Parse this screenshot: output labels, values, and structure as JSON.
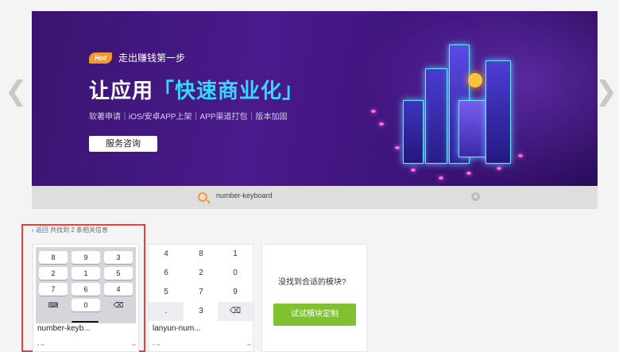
{
  "banner": {
    "hot_badge": "Hot",
    "hot_text": "走出赚钱第一步",
    "title_prefix": "让应用",
    "title_highlight": "「快速商业化」",
    "subtitle": "软著申请｜iOS/安卓APP上架｜APP渠道打包｜版本加固",
    "consult_button": "服务咨询",
    "prev_arrow": "❮",
    "next_arrow": "❯"
  },
  "search": {
    "query": "number-keyboard",
    "clear_symbol": "✕"
  },
  "results": {
    "back_label": "‹ 返回",
    "summary": "共找到 2 条相关信息",
    "cards": [
      {
        "name": "number-keyb...",
        "keys": [
          "8",
          "9",
          "3",
          "2",
          "1",
          "5",
          "7",
          "6",
          "4",
          "⌨",
          "0",
          "⌫"
        ]
      },
      {
        "name": "lanyun-num...",
        "keys": [
          "4",
          "8",
          "1",
          "6",
          "2",
          "0",
          "5",
          "7",
          "9",
          ".",
          "3",
          "⌫"
        ]
      }
    ],
    "custom": {
      "prompt": "没找到合适的模块?",
      "button": "试试模块定制"
    }
  },
  "colors": {
    "accent_orange": "#f29a2e",
    "accent_green": "#7fc12f",
    "highlight_red": "#e34141",
    "banner_purple": "#4a1a8c",
    "title_cyan": "#38d7ff"
  }
}
